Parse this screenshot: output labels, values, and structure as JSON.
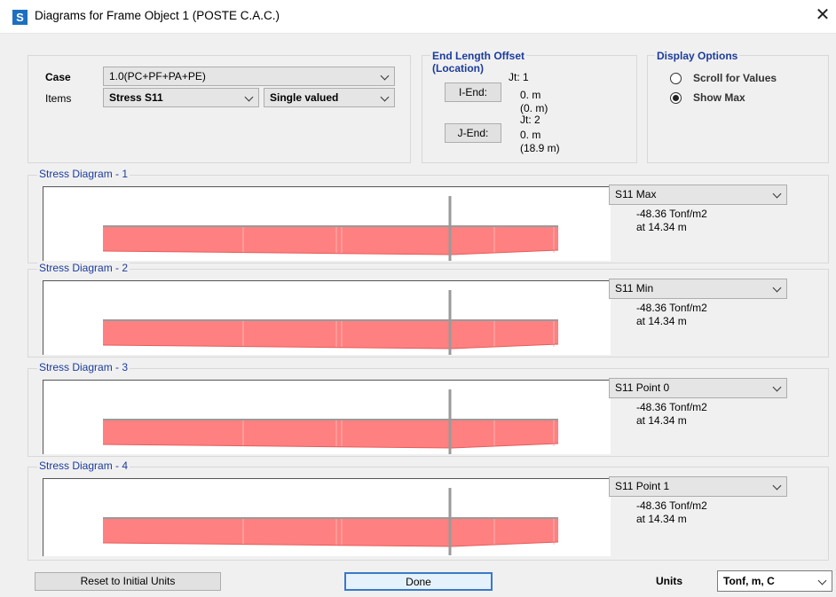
{
  "window": {
    "icon_letter": "S",
    "title": "Diagrams for Frame Object 1  (POSTE C.A.C.)",
    "close_glyph": "✕"
  },
  "case": {
    "label": "Case",
    "value": "1.0(PC+PF+PA+PE)"
  },
  "items": {
    "label": "Items",
    "value": "Stress S11",
    "mode": "Single valued"
  },
  "end_length_offset": {
    "legend_line1": "End Length Offset",
    "legend_line2": "(Location)",
    "i_end_button": "I-End:",
    "j_end_button": "J-End:",
    "jt1": "Jt:  1",
    "i_value": "0. m",
    "i_loc": "(0. m)",
    "jt2": "Jt:  2",
    "j_value": "0. m",
    "j_loc": "(18.9 m)"
  },
  "display_options": {
    "legend": "Display Options",
    "scroll_label": "Scroll for Values",
    "show_max_label": "Show Max",
    "selected": "show_max"
  },
  "diagrams": [
    {
      "title": "Stress Diagram - 1",
      "selector": "S11 Max",
      "value": "-48.36 Tonf/m2",
      "location": "at 14.34 m"
    },
    {
      "title": "Stress Diagram - 2",
      "selector": "S11 Min",
      "value": "-48.36 Tonf/m2",
      "location": "at 14.34 m"
    },
    {
      "title": "Stress Diagram - 3",
      "selector": "S11 Point 0",
      "value": "-48.36 Tonf/m2",
      "location": "at 14.34 m"
    },
    {
      "title": "Stress Diagram - 4",
      "selector": "S11 Point 1",
      "value": "-48.36 Tonf/m2",
      "location": "at 14.34 m"
    }
  ],
  "footer": {
    "reset_button": "Reset to Initial Units",
    "done_button": "Done",
    "units_label": "Units",
    "units_value": "Tonf, m, C"
  },
  "colors": {
    "diagram_fill": "#ff8080",
    "diagram_stroke": "#e85b5b",
    "baseline": "#9a9a9a",
    "legend_text": "#1c3c9c"
  }
}
